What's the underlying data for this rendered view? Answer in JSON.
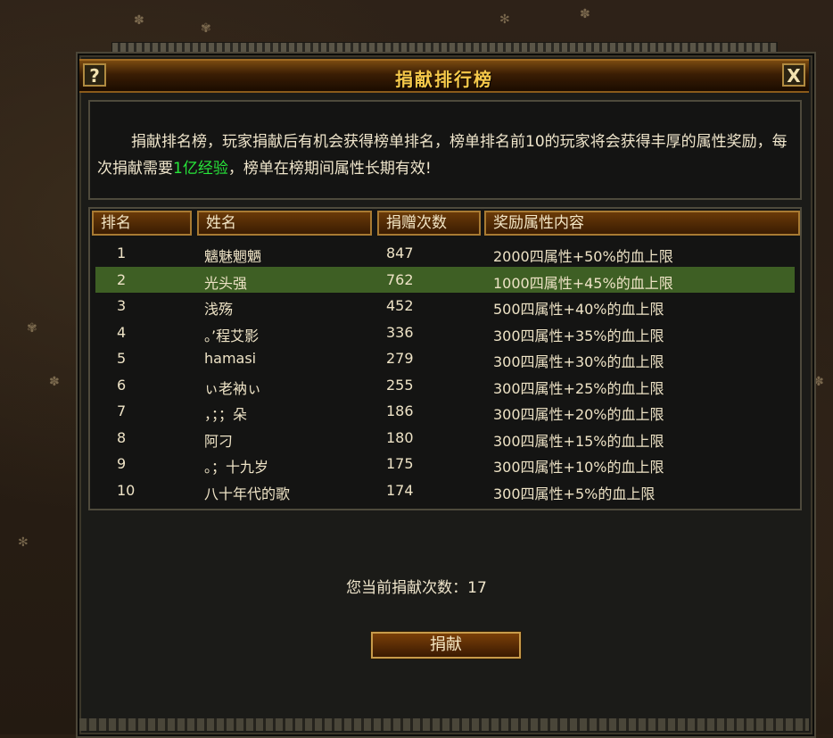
{
  "dialog": {
    "title": "捐献排行榜",
    "help_label": "?",
    "close_label": "X"
  },
  "intro": {
    "text_before": "捐献排名榜，玩家捐献后有机会获得榜单排名，榜单排名前10的玩家将会获得丰厚的属性奖励，每次捐献需要",
    "highlight": "1亿经验",
    "text_after": "，榜单在榜期间属性长期有效!",
    "highlight_color": "#27e63a"
  },
  "table": {
    "headers": [
      "排名",
      "姓名",
      "捐赠次数",
      "奖励属性内容"
    ],
    "rows": [
      {
        "rank": "1",
        "name": "魑魅魍魉",
        "count": "847",
        "reward": "2000四属性+50%的血上限"
      },
      {
        "rank": "2",
        "name": "光头强",
        "count": "762",
        "reward": "1000四属性+45%的血上限"
      },
      {
        "rank": "3",
        "name": "浅殇",
        "count": "452",
        "reward": "500四属性+40%的血上限"
      },
      {
        "rank": "4",
        "name": "。’程艾影",
        "count": "336",
        "reward": "300四属性+35%的血上限"
      },
      {
        "rank": "5",
        "name": "hamasi",
        "count": "279",
        "reward": "300四属性+30%的血上限"
      },
      {
        "rank": "6",
        "name": "ぃ老衲ぃ",
        "count": "255",
        "reward": "300四属性+25%的血上限"
      },
      {
        "rank": "7",
        "name": "，；；朵",
        "count": "186",
        "reward": "300四属性+20%的血上限"
      },
      {
        "rank": "8",
        "name": "阿刁",
        "count": "180",
        "reward": "300四属性+15%的血上限"
      },
      {
        "rank": "9",
        "name": "。；十九岁",
        "count": "175",
        "reward": "300四属性+10%的血上限"
      },
      {
        "rank": "10",
        "name": "八十年代的歌",
        "count": "174",
        "reward": "300四属性+5%的血上限"
      }
    ],
    "selected_row": "2",
    "selected_color": "#3e5f24"
  },
  "current": {
    "label": "您当前捐献次数：",
    "value": "17"
  },
  "donate_button": "捐献"
}
